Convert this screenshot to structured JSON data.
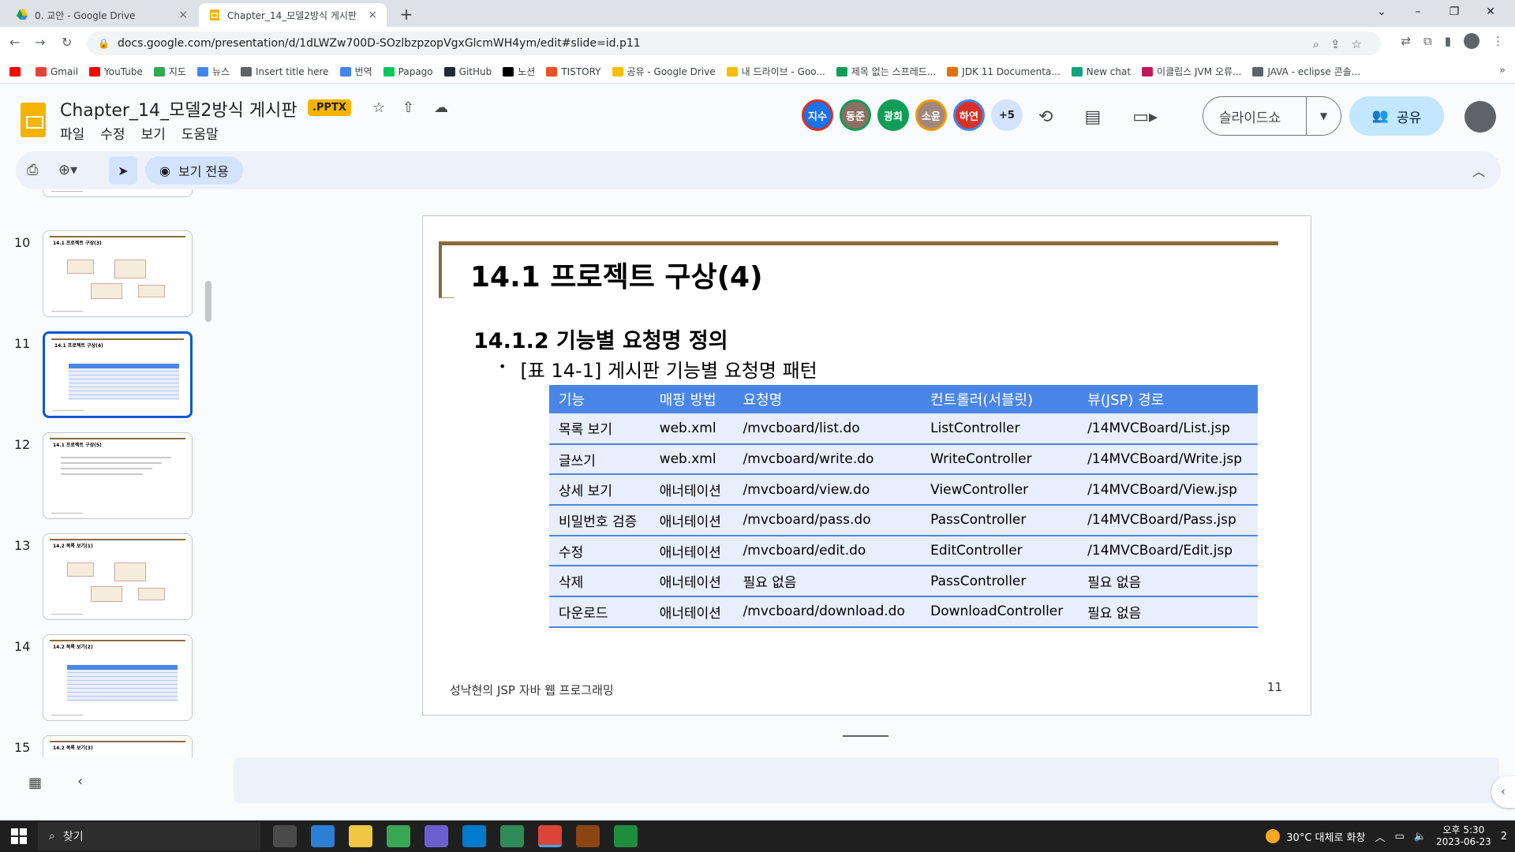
{
  "browser": {
    "tabs": [
      {
        "label": "0. 교안 - Google Drive",
        "close": "×"
      },
      {
        "label": "Chapter_14_모델2방식 게시판",
        "close": "×"
      }
    ],
    "new_tab": "+",
    "window_controls": {
      "dropdown": "⌄",
      "minimize": "–",
      "restore": "❐",
      "close": "✕"
    },
    "url": "docs.google.com/presentation/d/1dLWZw700D-SOzlbzpzopVgxGlcmWH4ym/edit#slide=id.p11",
    "bookmarks": [
      {
        "label": "",
        "color": "#ff0000"
      },
      {
        "label": "Gmail",
        "color": "#ea4335"
      },
      {
        "label": "YouTube",
        "color": "#ff0000"
      },
      {
        "label": "지도",
        "color": "#34a853"
      },
      {
        "label": "뉴스",
        "color": "#4285f4"
      },
      {
        "label": "Insert title here",
        "color": "#5f6368"
      },
      {
        "label": "번역",
        "color": "#4285f4"
      },
      {
        "label": "Papago",
        "color": "#03c75a"
      },
      {
        "label": "GitHub",
        "color": "#24292f"
      },
      {
        "label": "노션",
        "color": "#000000"
      },
      {
        "label": "TISTORY",
        "color": "#eb531f"
      },
      {
        "label": "공유 - Google Drive",
        "color": "#fbbc04"
      },
      {
        "label": "내 드라이브 - Goo...",
        "color": "#fbbc04"
      },
      {
        "label": "제목 없는 스프레드...",
        "color": "#0f9d58"
      },
      {
        "label": "JDK 11 Documenta...",
        "color": "#e76f00"
      },
      {
        "label": "New chat",
        "color": "#10a37f"
      },
      {
        "label": "이클립스 JVM 오류...",
        "color": "#c2185b"
      },
      {
        "label": "JAVA - eclipse 콘솔...",
        "color": "#5f6368"
      }
    ],
    "bookmarks_more": "»"
  },
  "app": {
    "title": "Chapter_14_모델2방식 게시판",
    "badge": ".PPTX",
    "menus": [
      "파일",
      "수정",
      "보기",
      "도움말"
    ],
    "collaborators": [
      {
        "name": "지수",
        "color": "#1a73e8",
        "ring": "#d93025"
      },
      {
        "name": "동준",
        "color": "#8d6e63",
        "ring": "#0f9d58"
      },
      {
        "name": "광희",
        "color": "#0f9d58",
        "ring": "#0f9d58"
      },
      {
        "name": "소윤",
        "color": "#a1887f",
        "ring": "#f29900"
      },
      {
        "name": "하연",
        "color": "#d93025",
        "ring": "#4285f4"
      }
    ],
    "collaborators_more": "+5",
    "present_label": "슬라이드쇼",
    "share_label": "공유",
    "view_only_label": "보기 전용",
    "colors": {
      "accent": "#0b57d0",
      "share_bg": "#c2e7ff",
      "table_header": "#4a86e8",
      "title_bar": "#8b6a3e"
    }
  },
  "filmstrip": {
    "slides": [
      {
        "num": "10",
        "title": "14.1 프로젝트 구상(3)",
        "kind": "diagram",
        "selected": false
      },
      {
        "num": "11",
        "title": "14.1 프로젝트 구상(4)",
        "kind": "table",
        "selected": true
      },
      {
        "num": "12",
        "title": "14.1 프로젝트 구상(5)",
        "kind": "text",
        "selected": false
      },
      {
        "num": "13",
        "title": "14.2 목록 보기(1)",
        "kind": "diagram",
        "selected": false
      },
      {
        "num": "14",
        "title": "14.2 목록 보기(2)",
        "kind": "table",
        "selected": false
      },
      {
        "num": "15",
        "title": "14.2 목록 보기(3)",
        "kind": "text",
        "selected": false
      }
    ]
  },
  "slide": {
    "title": "14.1 프로젝트 구상(4)",
    "subtitle": "14.1.2 기능별 요청명 정의",
    "bullet": "[표 14-1] 게시판 기능별 요청명 패턴",
    "table": {
      "headers": [
        "기능",
        "매핑 방법",
        "요청명",
        "컨트롤러(서블릿)",
        "뷰(JSP) 경로"
      ],
      "rows": [
        [
          "목록 보기",
          "web.xml",
          "/mvcboard/list.do",
          "ListController",
          "/14MVCBoard/List.jsp"
        ],
        [
          "글쓰기",
          "web.xml",
          "/mvcboard/write.do",
          "WriteController",
          "/14MVCBoard/Write.jsp"
        ],
        [
          "상세 보기",
          "애너테이션",
          "/mvcboard/view.do",
          "ViewController",
          "/14MVCBoard/View.jsp"
        ],
        [
          "비밀번호 검증",
          "애너테이션",
          "/mvcboard/pass.do",
          "PassController",
          "/14MVCBoard/Pass.jsp"
        ],
        [
          "수정",
          "애너테이션",
          "/mvcboard/edit.do",
          "EditController",
          "/14MVCBoard/Edit.jsp"
        ],
        [
          "삭제",
          "애너테이션",
          "필요 없음",
          "PassController",
          "필요 없음"
        ],
        [
          "다운로드",
          "애너테이션",
          "/mvcboard/download.do",
          "DownloadController",
          "필요 없음"
        ]
      ]
    },
    "footer": "성낙현의 JSP 자바 웹 프로그래밍",
    "page_number": "11"
  },
  "taskbar": {
    "search_label": "찾기",
    "weather": "30°C 대체로 화창",
    "time": "오후 5:30",
    "date": "2023-06-23",
    "notifications": "2"
  }
}
